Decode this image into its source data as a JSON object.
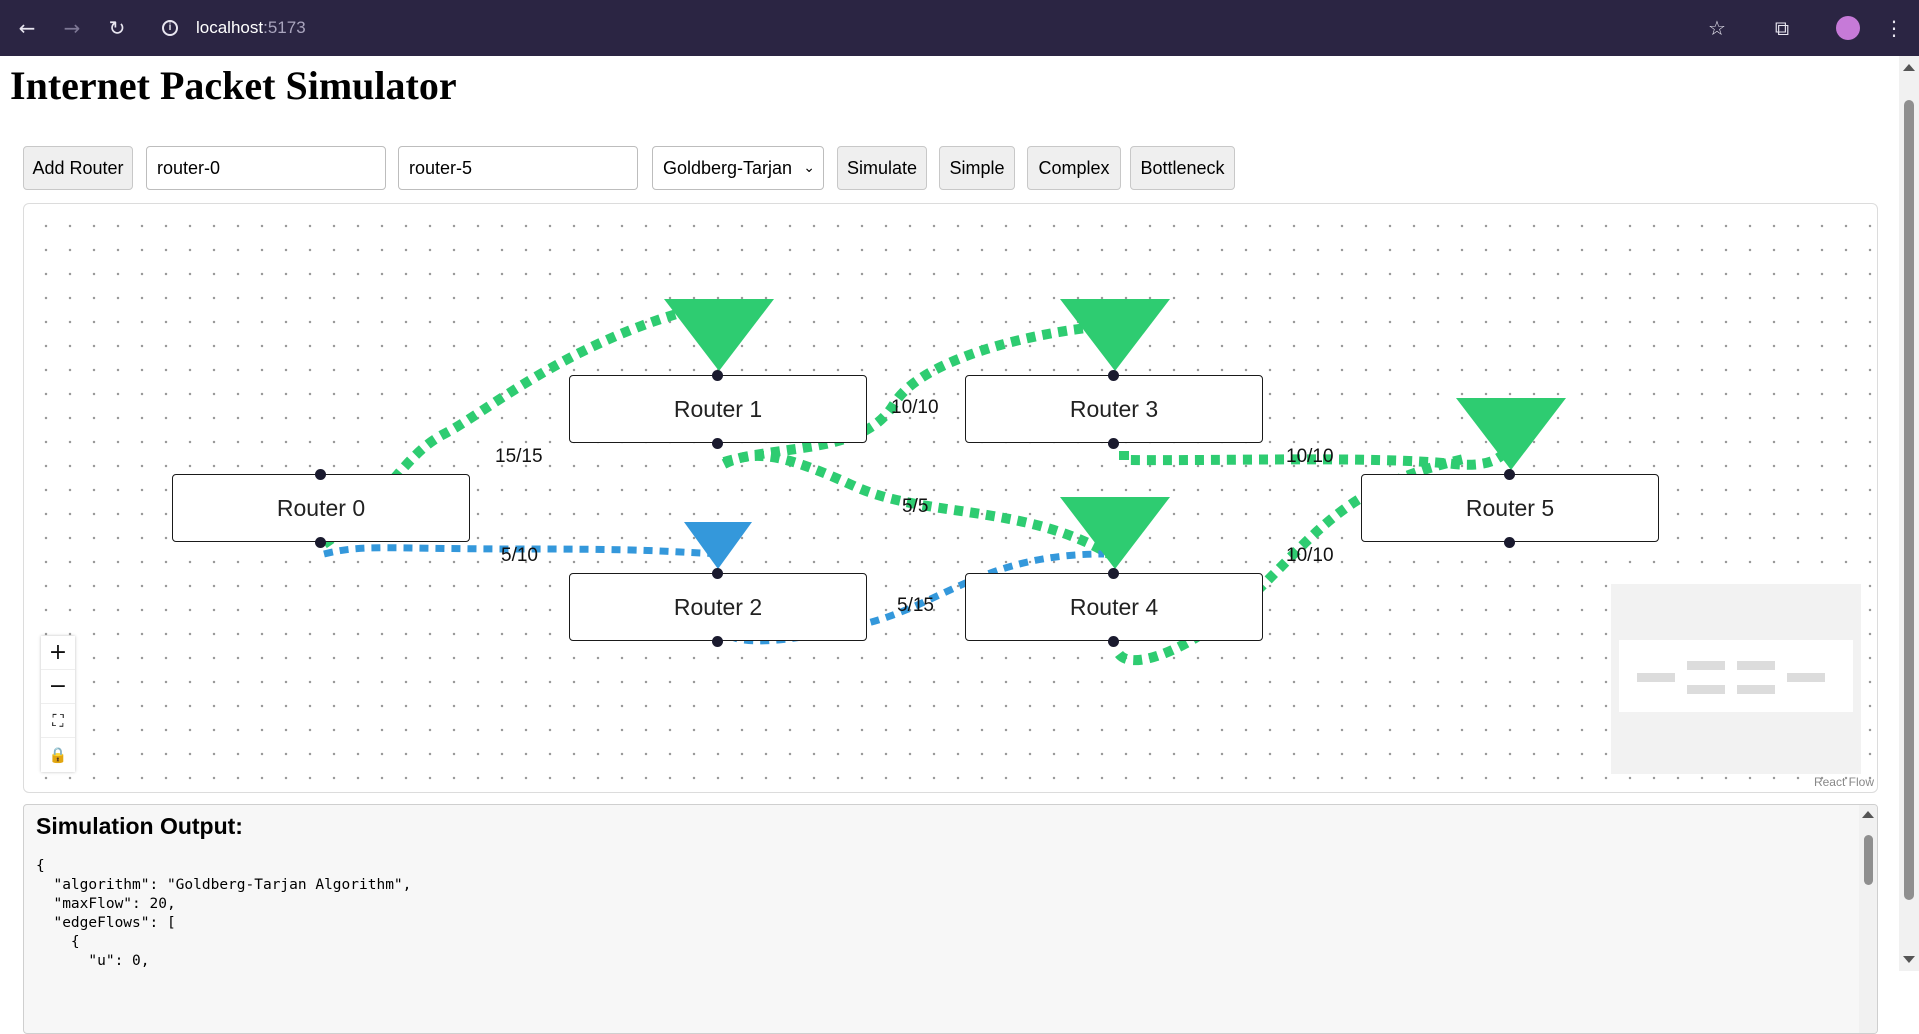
{
  "browser": {
    "url_host": "localhost",
    "url_port": ":5173"
  },
  "page": {
    "title": "Internet Packet Simulator"
  },
  "toolbar": {
    "add_router_label": "Add Router",
    "source_value": "router-0",
    "sink_value": "router-5",
    "algorithm_selected": "Goldberg-Tarjan",
    "simulate_label": "Simulate",
    "simple_label": "Simple",
    "complex_label": "Complex",
    "bottleneck_label": "Bottleneck"
  },
  "graph": {
    "nodes": [
      {
        "id": "router-0",
        "label": "Router 0"
      },
      {
        "id": "router-1",
        "label": "Router 1"
      },
      {
        "id": "router-2",
        "label": "Router 2"
      },
      {
        "id": "router-3",
        "label": "Router 3"
      },
      {
        "id": "router-4",
        "label": "Router 4"
      },
      {
        "id": "router-5",
        "label": "Router 5"
      }
    ],
    "edges": [
      {
        "from": "router-0",
        "to": "router-1",
        "label": "15/15",
        "color": "#2ecc71"
      },
      {
        "from": "router-0",
        "to": "router-2",
        "label": "5/10",
        "color": "#3498db"
      },
      {
        "from": "router-1",
        "to": "router-3",
        "label": "10/10",
        "color": "#2ecc71"
      },
      {
        "from": "router-1",
        "to": "router-4",
        "label": "5/5",
        "color": "#2ecc71"
      },
      {
        "from": "router-2",
        "to": "router-4",
        "label": "5/15",
        "color": "#3498db"
      },
      {
        "from": "router-3",
        "to": "router-5",
        "label": "10/10",
        "color": "#2ecc71"
      },
      {
        "from": "router-4",
        "to": "router-5",
        "label": "10/10",
        "color": "#2ecc71"
      }
    ],
    "saturated_color": "#2ecc71",
    "partial_color": "#3498db",
    "attribution": "React Flow"
  },
  "output": {
    "heading": "Simulation Output:",
    "json_text": "{\n  \"algorithm\": \"Goldberg-Tarjan Algorithm\",\n  \"maxFlow\": 20,\n  \"edgeFlows\": [\n    {\n      \"u\": 0,"
  }
}
